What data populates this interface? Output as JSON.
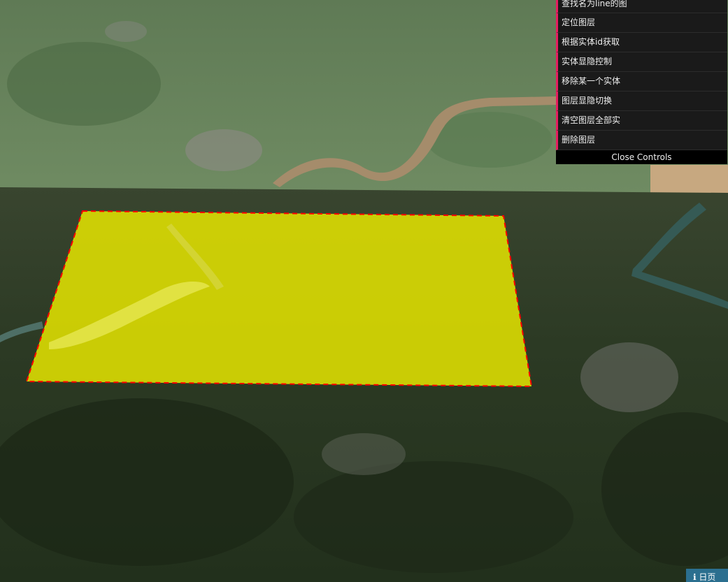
{
  "controls": {
    "items": [
      {
        "label": "查找名为line的图"
      },
      {
        "label": "定位图层"
      },
      {
        "label": "根据实体id获取"
      },
      {
        "label": "实体显隐控制"
      },
      {
        "label": "移除某一个实体"
      },
      {
        "label": "图层显隐切换"
      },
      {
        "label": "清空图层全部实"
      },
      {
        "label": "删除图层"
      }
    ],
    "close_label": "Close Controls"
  },
  "colors": {
    "panel_bg": "#1a1a1a",
    "accent": "#e61d5f",
    "polygon_fill": "#e6e600",
    "polygon_outline": "#ff0000"
  },
  "map": {
    "entity": "yellow-polygon",
    "outline_style": "dashed"
  },
  "corner_badge": {
    "label": "ℹ 日页"
  }
}
